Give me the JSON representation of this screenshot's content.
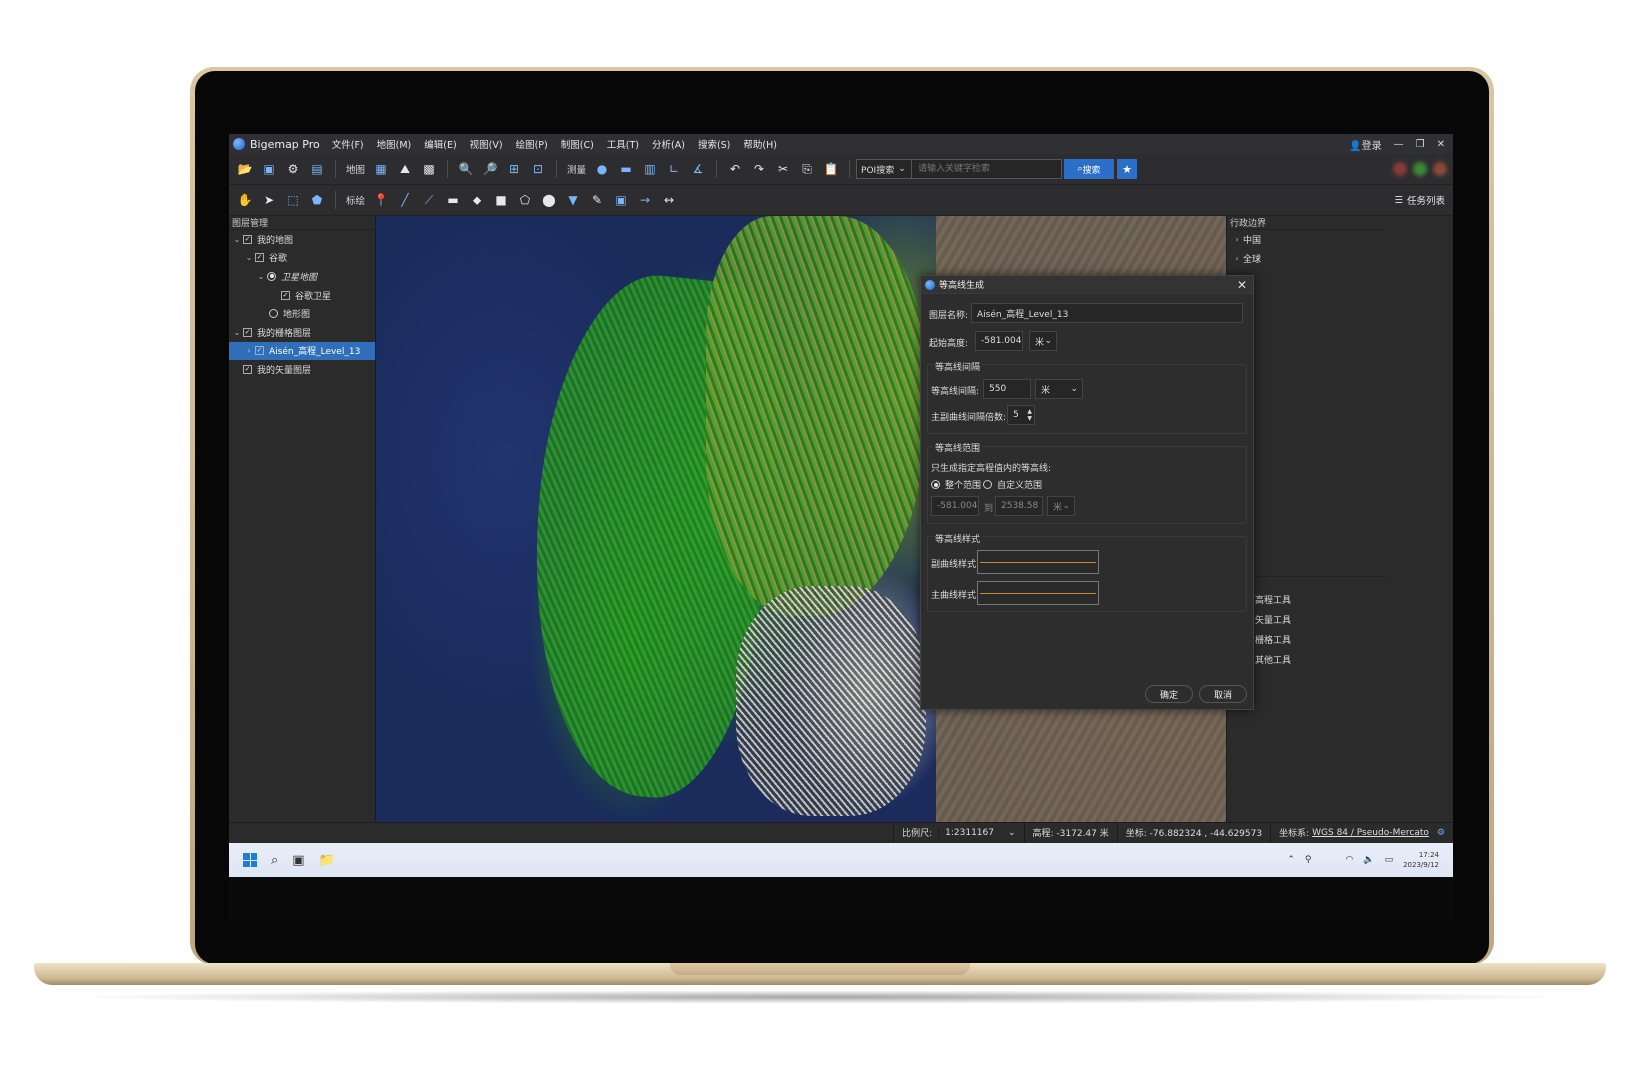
{
  "app": {
    "title": "Bigemap Pro",
    "login_label": "登录"
  },
  "menu": [
    "文件(F)",
    "地图(M)",
    "编辑(E)",
    "视图(V)",
    "绘图(P)",
    "制图(C)",
    "工具(T)",
    "分析(A)",
    "搜索(S)",
    "帮助(H)"
  ],
  "toolbar1": {
    "map_label": "地图",
    "measure_label": "测量",
    "poi_label": "POI搜索",
    "search_placeholder": "请输入关键字检索",
    "search_button": "搜索"
  },
  "toolbar2": {
    "annotate_label": "标绘",
    "task_list": "任务列表"
  },
  "layer_panel": {
    "title": "图层管理",
    "rows": [
      "我的地图",
      "谷歌",
      "卫星地图",
      "谷歌卫星",
      "地形图",
      "我的栅格图层",
      "Aisén_高程_Level_13",
      "我的矢量图层"
    ]
  },
  "right_panel": {
    "title": "行政边界",
    "regions": [
      "中国",
      "全球"
    ],
    "tools": [
      "高程工具",
      "矢量工具",
      "栅格工具",
      "其他工具"
    ]
  },
  "dialog": {
    "title": "等高线生成",
    "layer_name_label": "图层名称:",
    "layer_name_value": "Aisén_高程_Level_13",
    "start_height_label": "起始高度:",
    "start_height_value": "-581.004",
    "unit": "米",
    "interval_group": "等高线间隔",
    "interval_label": "等高线间隔:",
    "interval_value": "550",
    "major_multiple_label": "主副曲线间隔倍数:",
    "major_multiple_value": "5",
    "range_group": "等高线范围",
    "range_desc": "只生成指定高程值内的等高线:",
    "range_full": "整个范围",
    "range_custom": "自定义范围",
    "range_min": "-581.004",
    "range_to": "到",
    "range_max": "2538.58",
    "style_group": "等高线样式",
    "minor_style_label": "副曲线样式",
    "major_style_label": "主曲线样式",
    "ok": "确定",
    "cancel": "取消"
  },
  "status": {
    "scale_label": "比例尺:",
    "scale_value": "1:2311167",
    "elevation": "高程: -3172.47 米",
    "coords": "坐标: -76.882324 , -44.629573",
    "crs_label": "坐标系:",
    "crs_value": "WGS 84 / Pseudo-Mercato"
  },
  "taskbar": {
    "time": "17:24",
    "date": "2023/9/12"
  },
  "colors": {
    "accent": "#2c6fc8",
    "selection": "#2f6fba",
    "contour": "#c88a2b"
  }
}
